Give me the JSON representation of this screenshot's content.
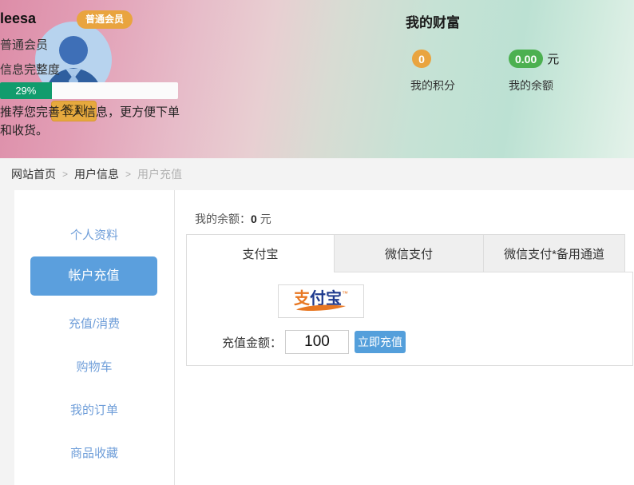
{
  "header": {
    "member_badge": "普通会员",
    "username": "leesa",
    "member_level": "普通会员",
    "completeness_label": "信息完整度",
    "completeness_percent": "29%",
    "tip_line1": "推荐您完善个人信息，更方便下单",
    "tip_line2": "和收货。",
    "checkin_label": "签到",
    "wealth": {
      "title": "我的财富",
      "points_value": "0",
      "points_label": "我的积分",
      "balance_value": "0.00",
      "balance_unit": "元",
      "balance_label": "我的余额"
    }
  },
  "breadcrumb": {
    "separator": ">",
    "items": [
      {
        "label": "网站首页"
      },
      {
        "label": "用户信息"
      },
      {
        "label": "用户充值"
      }
    ]
  },
  "sidebar": {
    "items": [
      {
        "label": "个人资料",
        "active": false
      },
      {
        "label": "帐户充值",
        "active": true
      },
      {
        "label": "充值/消费",
        "active": false
      },
      {
        "label": "购物车",
        "active": false
      },
      {
        "label": "我的订单",
        "active": false
      },
      {
        "label": "商品收藏",
        "active": false
      }
    ]
  },
  "main": {
    "balance_prefix": "我的余额：",
    "balance_value": "0",
    "balance_unit": "元",
    "tabs": [
      {
        "label": "支付宝",
        "active": true
      },
      {
        "label": "微信支付",
        "active": false
      },
      {
        "label": "微信支付*备用通道",
        "active": false
      }
    ],
    "alipay_logo": {
      "char1": "支",
      "chars23": "付宝",
      "tm": "™"
    },
    "recharge_label": "充值金额：",
    "amount_value": "100",
    "recharge_button": "立即充值"
  },
  "colors": {
    "accent_blue": "#5b9fdd",
    "progress_green": "#119c6d",
    "badge_orange": "#e9a43f",
    "pill_green": "#4cb050",
    "alipay_navy": "#1e3a8e",
    "alipay_orange": "#e87722"
  }
}
